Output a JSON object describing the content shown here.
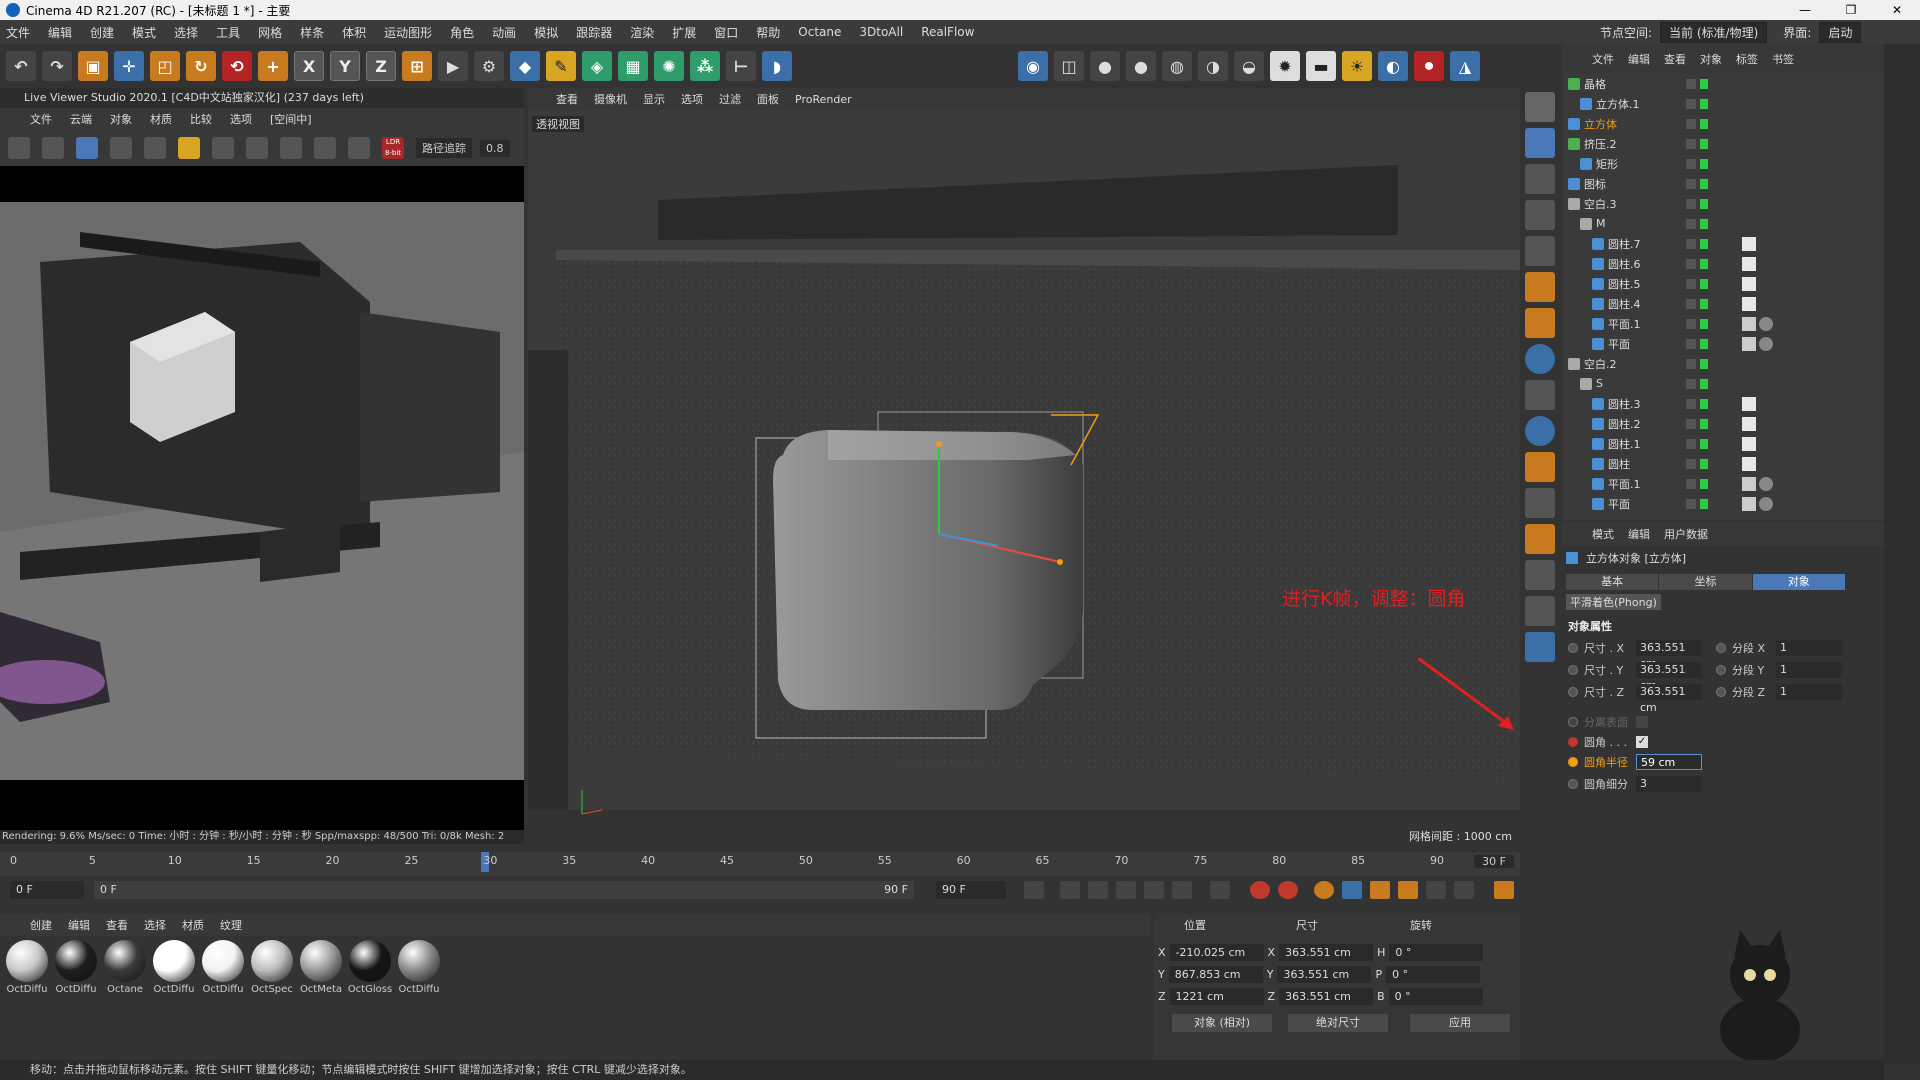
{
  "window": {
    "title": "Cinema 4D R21.207 (RC) - [未标题 1 *] - 主要",
    "controls": [
      "—",
      "❐",
      "✕"
    ]
  },
  "menubar": [
    "文件",
    "编辑",
    "创建",
    "模式",
    "选择",
    "工具",
    "网格",
    "样条",
    "体积",
    "运动图形",
    "角色",
    "动画",
    "模拟",
    "跟踪器",
    "渲染",
    "扩展",
    "窗口",
    "帮助",
    "Octane",
    "3DtoAll",
    "RealFlow"
  ],
  "layout": {
    "label": "节点空间:",
    "value": "当前 (标准/物理)",
    "interface": "界面:",
    "interface_value": "启动"
  },
  "live_viewer": {
    "title": "Live Viewer Studio 2020.1 [C4D中文站独家汉化] (237 days left)",
    "menu": [
      "文件",
      "云端",
      "对象",
      "材质",
      "比较",
      "选项",
      "[空间中]"
    ],
    "mode_select": "路径追踪",
    "mode_value": "0.8",
    "ldr_badge": "LDR 8-bit",
    "status": "Rendering: 9.6%    Ms/sec: 0    Time: 小时 : 分钟 : 秒/小时 : 分钟 : 秒    Spp/maxspp: 48/500    Tri: 0/8k    Mesh: 2"
  },
  "viewport": {
    "menu": [
      "查看",
      "摄像机",
      "显示",
      "选项",
      "过滤",
      "面板",
      "ProRender"
    ],
    "label": "透视视图",
    "grid_note": "网格间距 : 1000 cm",
    "annotation": "进行K帧，调整：圆角"
  },
  "object_manager": {
    "menu": [
      "文件",
      "编辑",
      "查看",
      "对象",
      "标签",
      "书签"
    ],
    "items": [
      {
        "name": "晶格",
        "indent": 0,
        "icon": "lattice-icon",
        "color": "#4caf50"
      },
      {
        "name": "立方体.1",
        "indent": 1,
        "icon": "cube-icon",
        "color": "#4a8fd8"
      },
      {
        "name": "立方体",
        "indent": 0,
        "icon": "cube-icon",
        "color": "#4a8fd8",
        "selected": true
      },
      {
        "name": "挤压.2",
        "indent": 0,
        "icon": "extrude-icon",
        "color": "#4caf50"
      },
      {
        "name": "矩形",
        "indent": 1,
        "icon": "spline-icon",
        "color": "#4a8fd8"
      },
      {
        "name": "图标",
        "indent": 0,
        "icon": "null-icon",
        "color": "#4a8fd8"
      },
      {
        "name": "空白.3",
        "indent": 0,
        "icon": "null-icon",
        "color": "#aaa"
      },
      {
        "name": "M",
        "indent": 1,
        "icon": "null-icon",
        "color": "#aaa"
      },
      {
        "name": "圆柱.7",
        "indent": 2,
        "icon": "cylinder-icon",
        "color": "#4a8fd8"
      },
      {
        "name": "圆柱.6",
        "indent": 2,
        "icon": "cylinder-icon",
        "color": "#4a8fd8"
      },
      {
        "name": "圆柱.5",
        "indent": 2,
        "icon": "cylinder-icon",
        "color": "#4a8fd8"
      },
      {
        "name": "圆柱.4",
        "indent": 2,
        "icon": "cylinder-icon",
        "color": "#4a8fd8"
      },
      {
        "name": "平面.1",
        "indent": 2,
        "icon": "plane-icon",
        "color": "#4a8fd8"
      },
      {
        "name": "平面",
        "indent": 2,
        "icon": "plane-icon",
        "color": "#4a8fd8"
      },
      {
        "name": "空白.2",
        "indent": 0,
        "icon": "null-icon",
        "color": "#aaa"
      },
      {
        "name": "S",
        "indent": 1,
        "icon": "null-icon",
        "color": "#aaa"
      },
      {
        "name": "圆柱.3",
        "indent": 2,
        "icon": "cylinder-icon",
        "color": "#4a8fd8"
      },
      {
        "name": "圆柱.2",
        "indent": 2,
        "icon": "cylinder-icon",
        "color": "#4a8fd8"
      },
      {
        "name": "圆柱.1",
        "indent": 2,
        "icon": "cylinder-icon",
        "color": "#4a8fd8"
      },
      {
        "name": "圆柱",
        "indent": 2,
        "icon": "cylinder-icon",
        "color": "#4a8fd8"
      },
      {
        "name": "平面.1",
        "indent": 2,
        "icon": "plane-icon",
        "color": "#4a8fd8"
      },
      {
        "name": "平面",
        "indent": 2,
        "icon": "plane-icon",
        "color": "#4a8fd8"
      }
    ]
  },
  "attribute_manager": {
    "menu": [
      "模式",
      "编辑",
      "用户数据"
    ],
    "title": "立方体对象 [立方体]",
    "tabs": [
      "基本",
      "坐标",
      "对象"
    ],
    "active_tab": "对象",
    "subtab": "平滑着色(Phong)",
    "section": "对象属性",
    "size_x_label": "尺寸 . X",
    "size_x": "363.551 cm",
    "size_y_label": "尺寸 . Y",
    "size_y": "363.551 cm",
    "size_z_label": "尺寸 . Z",
    "size_z": "363.551 cm",
    "seg_x_label": "分段 X",
    "seg_x": "1",
    "seg_y_label": "分段 Y",
    "seg_y": "1",
    "seg_z_label": "分段 Z",
    "seg_z": "1",
    "separate_label": "分离表面",
    "fillet_label": "圆角 . . .",
    "fillet_checked": "✓",
    "fillet_radius_label": "圆角半径",
    "fillet_radius": "59 cm",
    "fillet_subdiv_label": "圆角细分",
    "fillet_subdiv": "3"
  },
  "timeline": {
    "ticks": [
      "0",
      "5",
      "10",
      "15",
      "20",
      "25",
      "30",
      "35",
      "40",
      "45",
      "50",
      "55",
      "60",
      "65",
      "70",
      "75",
      "80",
      "85",
      "90"
    ],
    "current_frame": 30,
    "end_label": "30 F",
    "start": "0 F",
    "range_start": "0 F",
    "range_end": "90 F",
    "max": "90 F"
  },
  "materials": {
    "menu": [
      "创建",
      "编辑",
      "查看",
      "选择",
      "材质",
      "纹理"
    ],
    "items": [
      {
        "name": "OctDiffu",
        "color": "#c8c8c8"
      },
      {
        "name": "OctDiffu",
        "color": "#1e1e1e"
      },
      {
        "name": "Octane",
        "color": "#3a3a3a"
      },
      {
        "name": "OctDiffu",
        "color": "#ffffff"
      },
      {
        "name": "OctDiffu",
        "color": "#f2f2f2"
      },
      {
        "name": "OctSpec",
        "color": "#bdbdbd"
      },
      {
        "name": "OctMeta",
        "color": "#9a9a9a"
      },
      {
        "name": "OctGloss",
        "color": "#151515"
      },
      {
        "name": "OctDiffu",
        "color": "#8a8a8a"
      }
    ]
  },
  "coords": {
    "heads": [
      "位置",
      "尺寸",
      "旋转"
    ],
    "x_pos": "-210.025 cm",
    "y_pos": "867.853 cm",
    "z_pos": "1221 cm",
    "x_size": "363.551 cm",
    "y_size": "363.551 cm",
    "z_size": "363.551 cm",
    "h": "0 °",
    "p": "0 °",
    "b": "0 °",
    "mode": "对象 (相对)",
    "size_mode": "绝对尺寸",
    "apply": "应用"
  },
  "statusbar": "移动：点击并拖动鼠标移动元素。按住 SHIFT 键量化移动；节点编辑模式时按住 SHIFT 键增加选择对象；按住 CTRL 键减少选择对象。",
  "colors": {
    "accent": "#4a78b8",
    "selected": "#f39c12",
    "annotation": "#e02020"
  }
}
